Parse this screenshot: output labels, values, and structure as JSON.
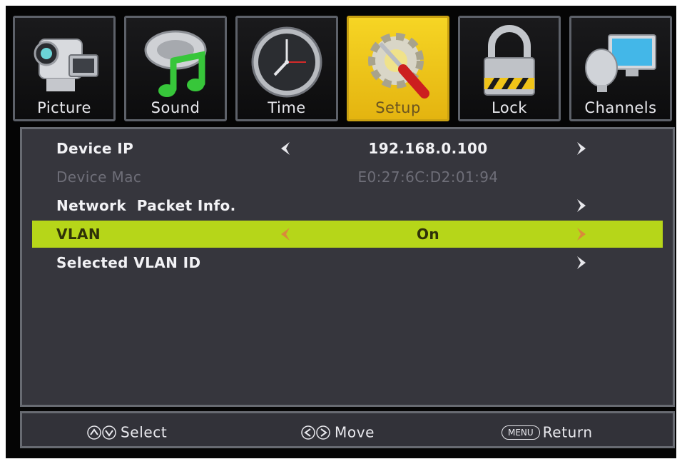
{
  "tabs": [
    {
      "id": "picture",
      "label": "Picture",
      "icon": "camcorder-icon",
      "active": false
    },
    {
      "id": "sound",
      "label": "Sound",
      "icon": "music-note-icon",
      "active": false
    },
    {
      "id": "time",
      "label": "Time",
      "icon": "clock-icon",
      "active": false
    },
    {
      "id": "setup",
      "label": "Setup",
      "icon": "gear-screwdriver-icon",
      "active": true
    },
    {
      "id": "lock",
      "label": "Lock",
      "icon": "padlock-icon",
      "active": false
    },
    {
      "id": "channels",
      "label": "Channels",
      "icon": "satellite-dish-icon",
      "active": false
    }
  ],
  "menu": {
    "rows": [
      {
        "label": "Device IP",
        "value": "192.168.0.100",
        "has_left": true,
        "has_right": true,
        "state": "normal"
      },
      {
        "label": "Device Mac",
        "value": "E0:27:6C:D2:01:94",
        "has_left": false,
        "has_right": false,
        "state": "disabled"
      },
      {
        "label": "Network  Packet Info.",
        "value": "",
        "has_left": false,
        "has_right": true,
        "state": "normal"
      },
      {
        "label": "VLAN",
        "value": "On",
        "has_left": true,
        "has_right": true,
        "state": "selected"
      },
      {
        "label": "Selected VLAN ID",
        "value": "",
        "has_left": false,
        "has_right": true,
        "state": "normal"
      }
    ]
  },
  "footer": {
    "select_label": "Select",
    "move_label": "Move",
    "menu_key": "MENU",
    "return_label": "Return"
  },
  "colors": {
    "highlight": "#b6d619",
    "active_tab": "#f6d524",
    "panel": "#36363d",
    "arrow_normal": "#e8e8ec",
    "arrow_selected": "#d98a3a"
  }
}
